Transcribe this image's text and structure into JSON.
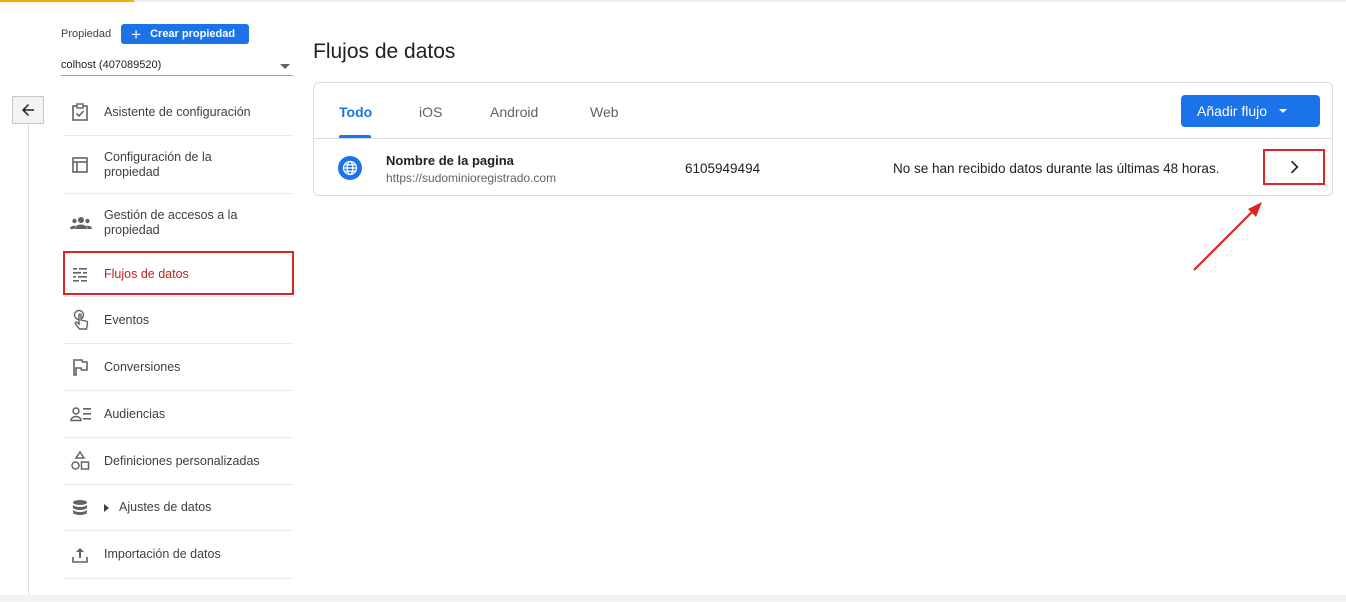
{
  "property": {
    "label": "Propiedad",
    "create_button": "Crear propiedad",
    "selected": "colhost (407089520)"
  },
  "nav": {
    "items": [
      {
        "label": "Asistente de configuración",
        "icon": "checklist-icon"
      },
      {
        "label": "Configuración de la propiedad",
        "icon": "layout-icon"
      },
      {
        "label": "Gestión de accesos a la propiedad",
        "icon": "people-icon"
      },
      {
        "label": "Flujos de datos",
        "icon": "streams-icon",
        "active": true
      },
      {
        "label": "Eventos",
        "icon": "touch-icon"
      },
      {
        "label": "Conversiones",
        "icon": "flag-icon"
      },
      {
        "label": "Audiencias",
        "icon": "audience-icon"
      },
      {
        "label": "Definiciones personalizadas",
        "icon": "shapes-icon"
      },
      {
        "label": "Ajustes de datos",
        "icon": "database-icon",
        "expandable": true
      },
      {
        "label": "Importación de datos",
        "icon": "upload-icon"
      }
    ]
  },
  "page": {
    "title": "Flujos de datos"
  },
  "tabs": [
    {
      "label": "Todo",
      "active": true
    },
    {
      "label": "iOS"
    },
    {
      "label": "Android"
    },
    {
      "label": "Web"
    }
  ],
  "add_button": "Añadir flujo",
  "stream": {
    "name": "Nombre de la pagina",
    "url": "https://sudominioregistrado.com",
    "id": "6105949494",
    "status": "No se han recibido datos durante las últimas 48 horas."
  },
  "colors": {
    "primary": "#1a73e8",
    "highlight": "#e02424",
    "accent": "#f9ab00"
  }
}
